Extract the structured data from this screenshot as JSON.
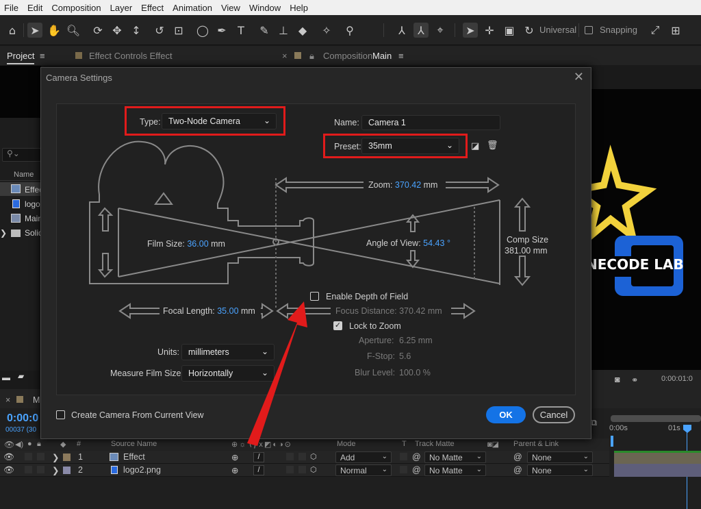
{
  "menu": [
    "File",
    "Edit",
    "Composition",
    "Layer",
    "Effect",
    "Animation",
    "View",
    "Window",
    "Help"
  ],
  "toolbar": {
    "universal_label": "Universal",
    "snapping_label": "Snapping"
  },
  "panels": {
    "project_tab": "Project",
    "effect_controls_tab": "Effect Controls Effect",
    "composition_tab_prefix": "Composition",
    "composition_tab_name": "Main"
  },
  "project": {
    "search_placeholder": "",
    "name_header": "Name",
    "items": [
      "Effec",
      "logo",
      "Main",
      "Solid"
    ]
  },
  "viewer": {
    "logo_text": "NECODE LAB",
    "timecode": "0:00:01:0"
  },
  "timeline": {
    "tab_label": "M",
    "timecode": "0:00:0",
    "frames": "00037 (30",
    "ruler_labels": [
      "0:00s",
      "01s"
    ],
    "header": {
      "number": "#",
      "source_name": "Source Name",
      "mode": "Mode",
      "t": "T",
      "track_matte": "Track Matte",
      "parent_link": "Parent & Link"
    },
    "layers": [
      {
        "number": "1",
        "name": "Effect",
        "mode": "Add",
        "matte": "No Matte",
        "parent": "None",
        "color": "#8c7a5c"
      },
      {
        "number": "2",
        "name": "logo2.png",
        "mode": "Normal",
        "matte": "No Matte",
        "parent": "None",
        "color": "#8a8aa8"
      }
    ]
  },
  "dialog": {
    "title": "Camera Settings",
    "type_label": "Type:",
    "type_value": "Two-Node Camera",
    "name_label": "Name:",
    "name_value": "Camera 1",
    "preset_label": "Preset:",
    "preset_value": "35mm",
    "zoom_label": "Zoom:",
    "zoom_value": "370.42",
    "zoom_unit": "mm",
    "film_size_label": "Film Size:",
    "film_size_value": "36.00",
    "film_size_unit": "mm",
    "angle_label": "Angle of View:",
    "angle_value": "54.43",
    "angle_unit": "°",
    "comp_size_label": "Comp Size",
    "comp_size_value": "381.00 mm",
    "focal_label": "Focal Length:",
    "focal_value": "35.00",
    "focal_unit": "mm",
    "dof_label": "Enable Depth of Field",
    "focus_distance_label": "Focus Distance:",
    "focus_distance_value": "370.42 mm",
    "lock_zoom_label": "Lock to Zoom",
    "aperture_label": "Aperture:",
    "aperture_value": "6.25 mm",
    "fstop_label": "F-Stop:",
    "fstop_value": "5.6",
    "blur_label": "Blur Level:",
    "blur_value": "100.0 %",
    "units_label": "Units:",
    "units_value": "millimeters",
    "measure_label": "Measure Film Size:",
    "measure_value": "Horizontally",
    "create_from_view_label": "Create Camera From Current View",
    "ok_label": "OK",
    "cancel_label": "Cancel",
    "lock_to_zoom_checked": true,
    "enable_dof_checked": false,
    "create_from_view_checked": false
  },
  "colors": {
    "accent_blue": "#1473e6",
    "value_blue": "#4aa3ff",
    "highlight_red": "#e11b1b",
    "star_yellow": "#f2d23c",
    "logo_blue": "#1c62d6"
  }
}
